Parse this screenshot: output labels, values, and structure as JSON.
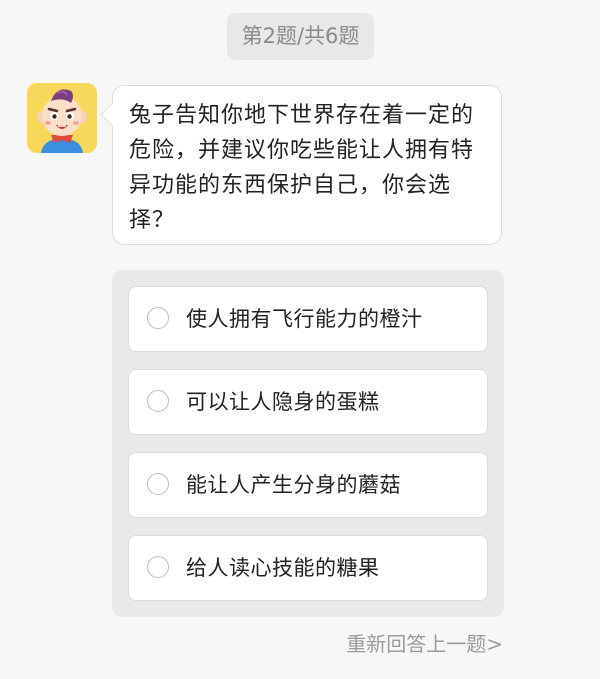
{
  "header": {
    "progress": "第2题/共6题"
  },
  "question": {
    "avatar_icon": "cartoon-boy-avatar-icon",
    "avatar_bg": "#f8d85a",
    "text": "兔子告知你地下世界存在着一定的危险，并建议你吃些能让人拥有特异功能的东西保护自己，你会选择？"
  },
  "options": [
    {
      "label": "使人拥有飞行能力的橙汁"
    },
    {
      "label": "可以让人隐身的蛋糕"
    },
    {
      "label": "能让人产生分身的蘑菇"
    },
    {
      "label": "给人读心技能的糖果"
    }
  ],
  "footer": {
    "redo_label": "重新回答上一题>"
  }
}
